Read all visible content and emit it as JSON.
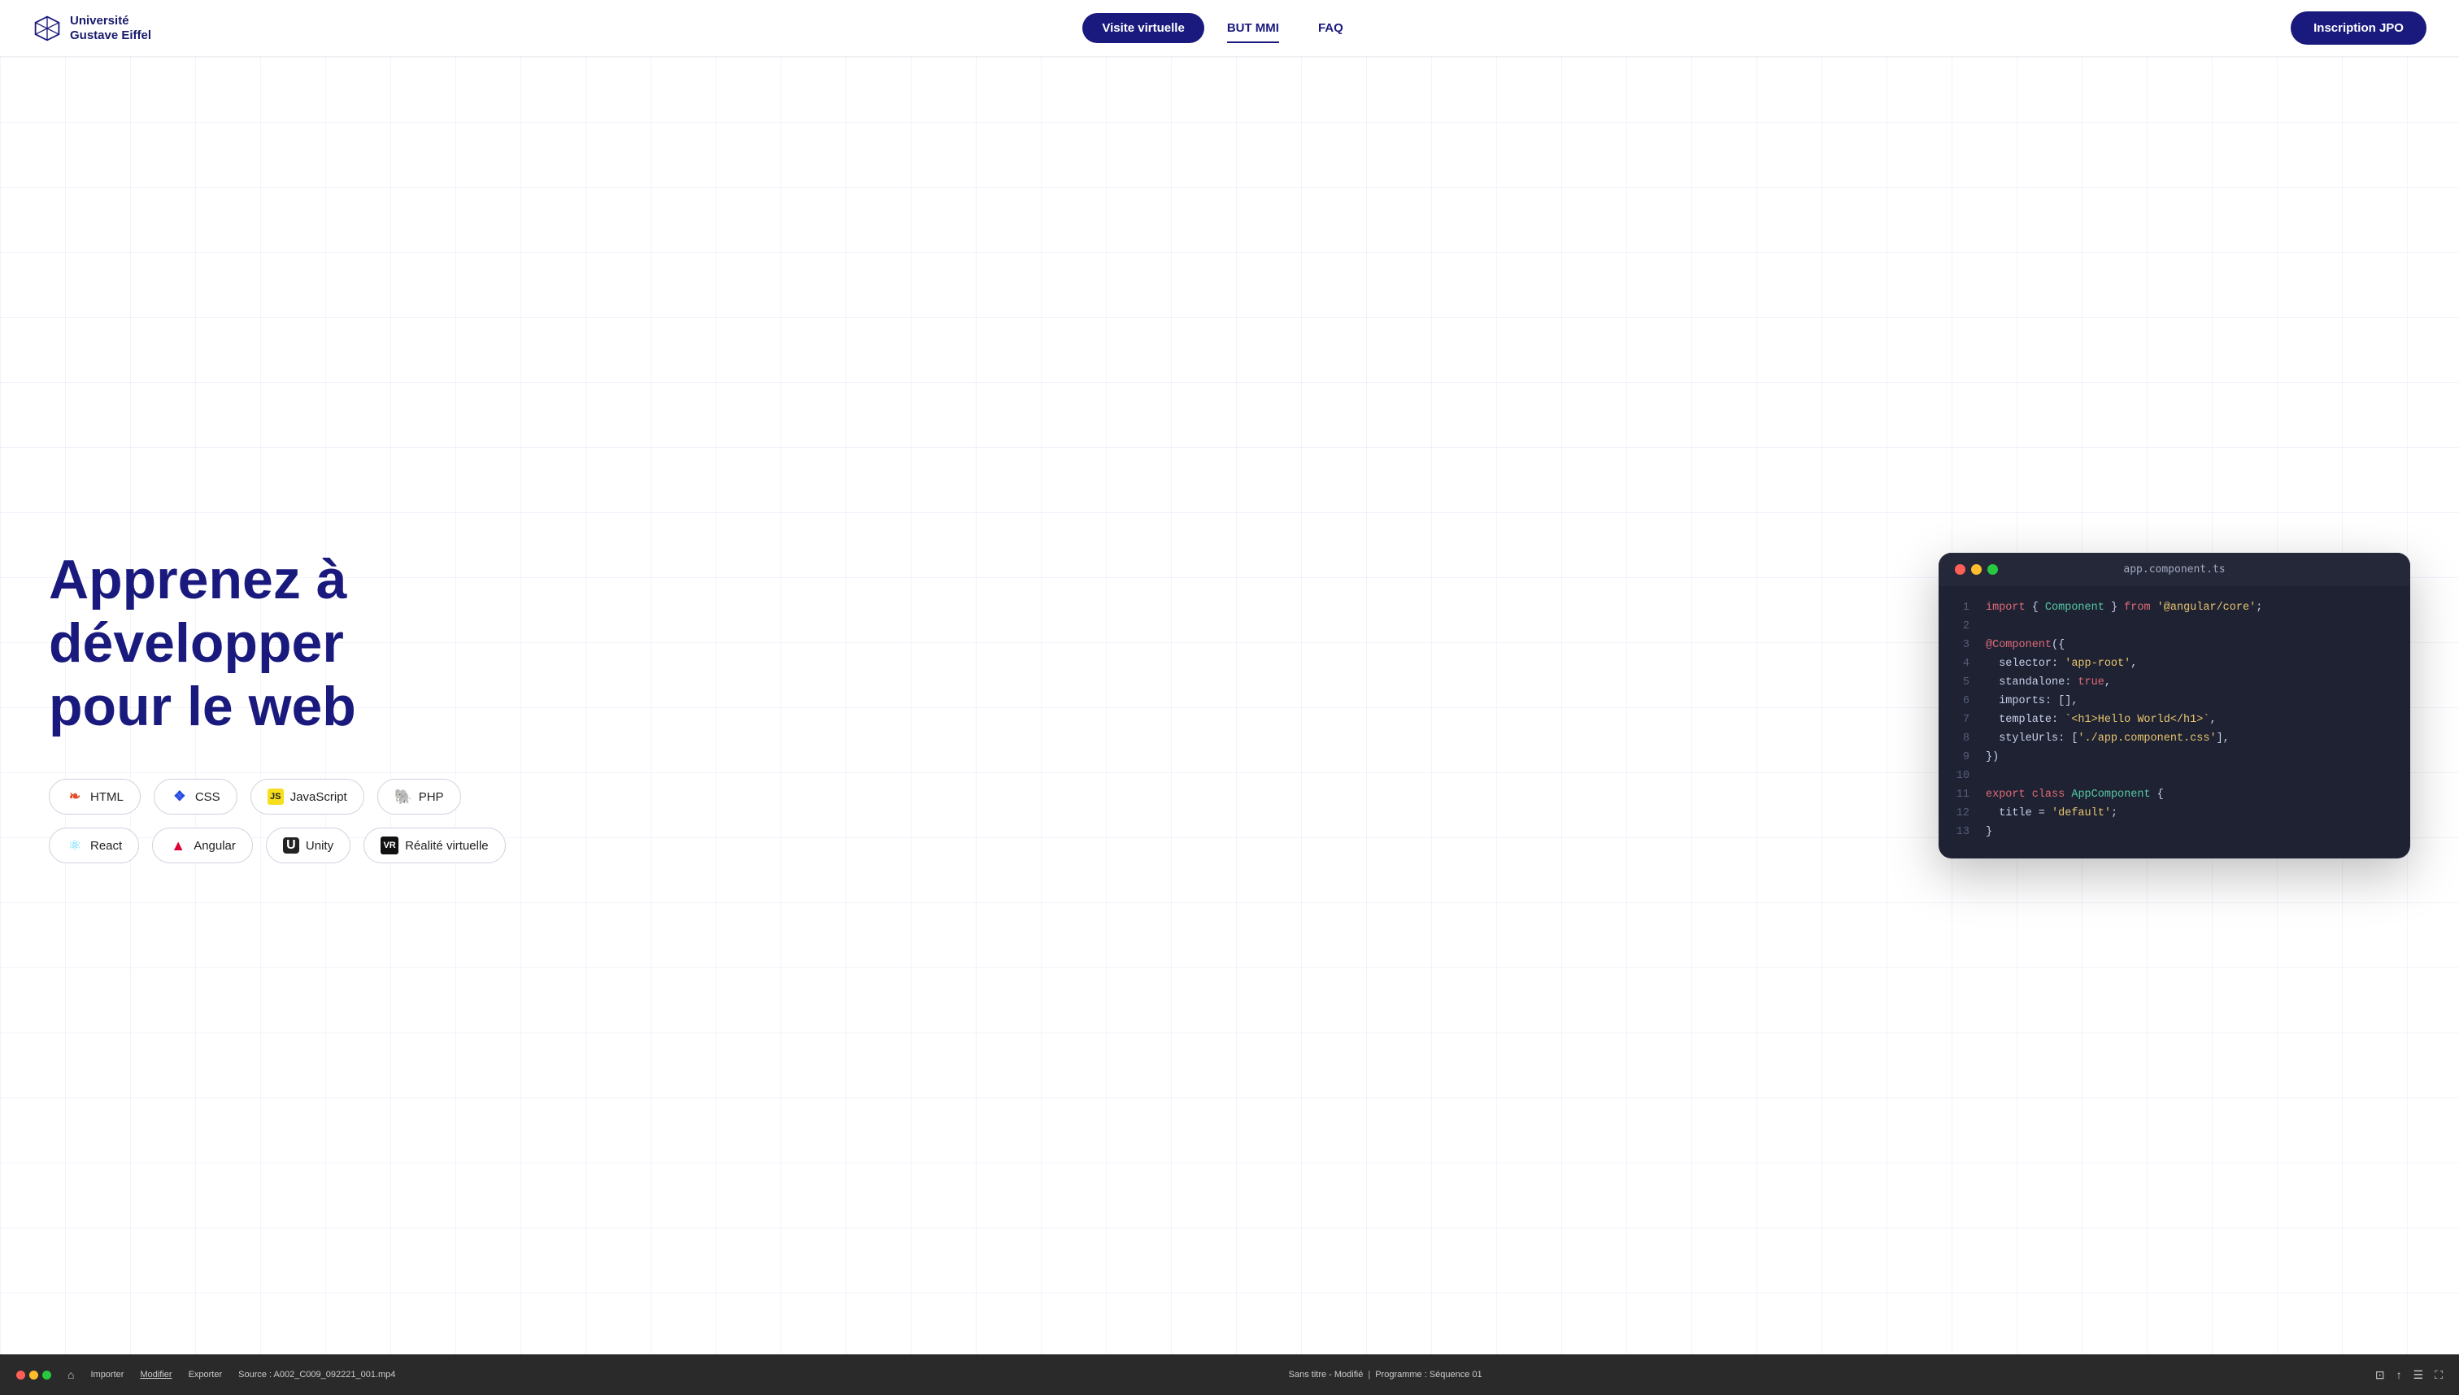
{
  "nav": {
    "logo_text": "Université\nGustave Eiffel",
    "btn_virtual": "Visite virtuelle",
    "link_but": "BUT MMI",
    "link_faq": "FAQ",
    "btn_inscription": "Inscription JPO"
  },
  "hero": {
    "title_line1": "Apprenez à développer",
    "title_line2": "pour le web",
    "tags": [
      [
        {
          "label": "HTML",
          "icon": "html"
        },
        {
          "label": "CSS",
          "icon": "css"
        },
        {
          "label": "JavaScript",
          "icon": "js"
        },
        {
          "label": "PHP",
          "icon": "php"
        }
      ],
      [
        {
          "label": "React",
          "icon": "react"
        },
        {
          "label": "Angular",
          "icon": "angular"
        },
        {
          "label": "Unity",
          "icon": "unity"
        },
        {
          "label": "Réalité virtuelle",
          "icon": "vr"
        }
      ]
    ]
  },
  "code_window": {
    "filename": "app.component.ts",
    "lines": [
      {
        "n": 1,
        "content": "import { Component } from '@angular/core';"
      },
      {
        "n": 2,
        "content": ""
      },
      {
        "n": 3,
        "content": "@Component({"
      },
      {
        "n": 4,
        "content": "  selector: 'app-root',"
      },
      {
        "n": 5,
        "content": "  standalone: true,"
      },
      {
        "n": 6,
        "content": "  imports: [],"
      },
      {
        "n": 7,
        "content": "  template: `<h1>Hello World</h1>`,"
      },
      {
        "n": 8,
        "content": "  styleUrls: ['./app.component.css'],"
      },
      {
        "n": 9,
        "content": "})"
      },
      {
        "n": 10,
        "content": ""
      },
      {
        "n": 11,
        "content": "export class AppComponent {"
      },
      {
        "n": 12,
        "content": "  title = 'default';"
      },
      {
        "n": 13,
        "content": "}"
      }
    ]
  },
  "bottom_bar": {
    "source": "Source : A002_C009_092221_001.mp4",
    "menu_items": [
      "Importer",
      "Modifier",
      "Exporter"
    ],
    "center_text": "Sans titre - Modifié",
    "program_label": "Programme : Séquence 01"
  }
}
